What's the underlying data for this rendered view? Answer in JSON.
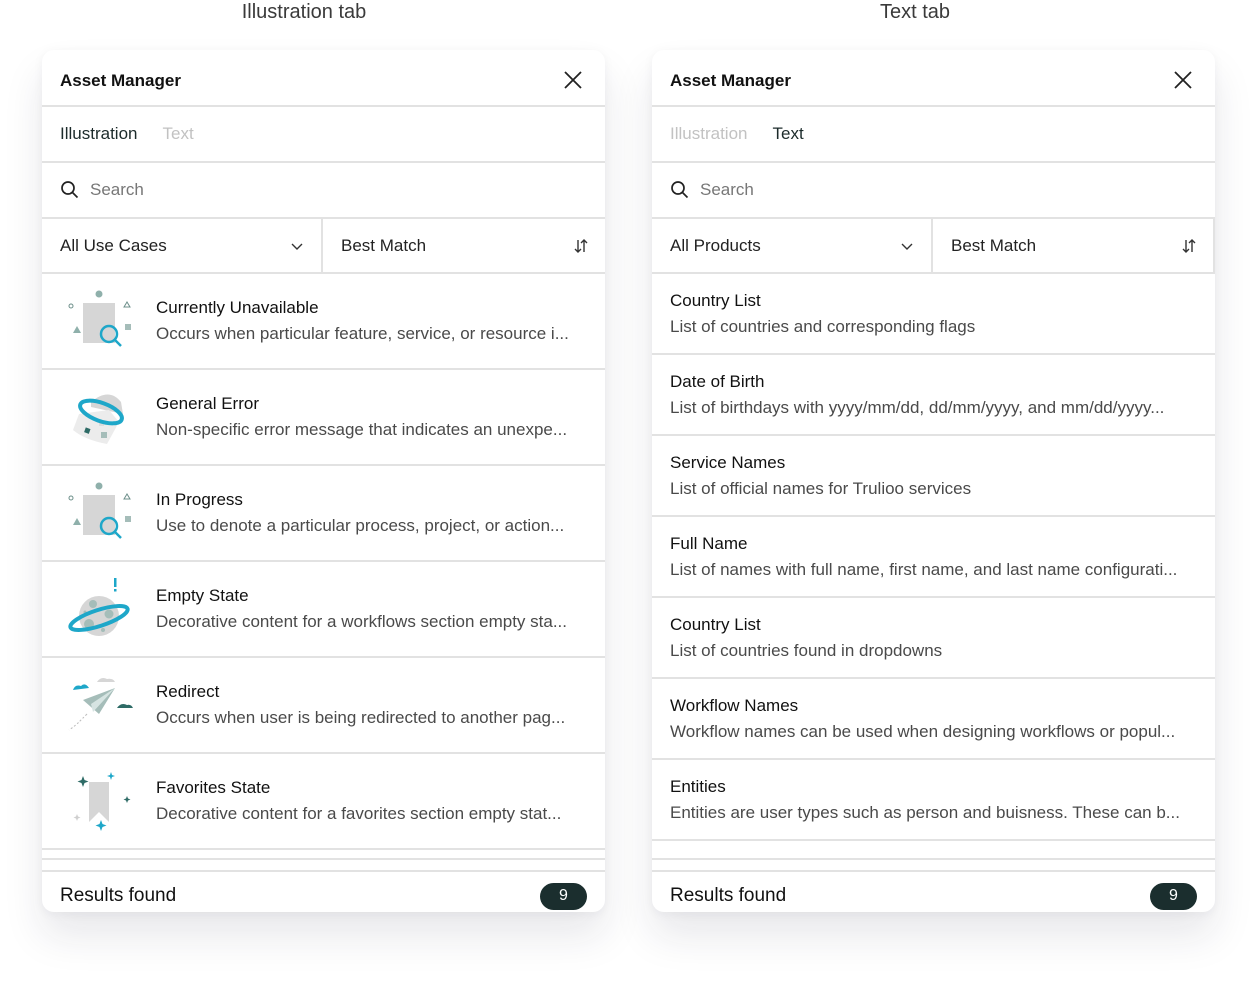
{
  "captions": {
    "left": "Illustration tab",
    "right": "Text tab"
  },
  "colors": {
    "accent_teal": "#1ea7c9",
    "dark_teal": "#2e6b66",
    "muted_teal": "#8fb0ab",
    "gray": "#d4d4d4",
    "badge_bg": "#1b2e2e"
  },
  "illustration_panel": {
    "title": "Asset Manager",
    "close_icon": "close-icon",
    "tabs": [
      {
        "label": "Illustration",
        "active": true
      },
      {
        "label": "Text",
        "active": false
      }
    ],
    "search": {
      "placeholder": "Search",
      "value": ""
    },
    "filter": {
      "selected": "All Use Cases",
      "icon": "chevron-down-icon"
    },
    "sort": {
      "selected": "Best Match",
      "icon": "sort-icon"
    },
    "items": [
      {
        "icon": "magnifier-illustration-icon",
        "title": "Currently Unavailable",
        "description": "Occurs when particular feature, service, or resource i..."
      },
      {
        "icon": "ufo-illustration-icon",
        "title": "General Error",
        "description": "Non-specific error message that indicates an unexpe..."
      },
      {
        "icon": "magnifier-illustration-icon",
        "title": "In Progress",
        "description": "Use to denote a particular process, project, or action..."
      },
      {
        "icon": "planet-illustration-icon",
        "title": "Empty State",
        "description": "Decorative content for a workflows section empty sta..."
      },
      {
        "icon": "paper-plane-illustration-icon",
        "title": "Redirect",
        "description": "Occurs when user is being redirected to another pag..."
      },
      {
        "icon": "bookmark-illustration-icon",
        "title": "Favorites State",
        "description": "Decorative content for a favorites section empty stat..."
      }
    ],
    "footer": {
      "label": "Results found",
      "count": "9"
    }
  },
  "text_panel": {
    "title": "Asset Manager",
    "close_icon": "close-icon",
    "tabs": [
      {
        "label": "Illustration",
        "active": false
      },
      {
        "label": "Text",
        "active": true
      }
    ],
    "search": {
      "placeholder": "Search",
      "value": ""
    },
    "filter": {
      "selected": "All Products",
      "icon": "chevron-down-icon"
    },
    "sort": {
      "selected": "Best Match",
      "icon": "sort-icon"
    },
    "items": [
      {
        "title": "Country List",
        "description": "List of countries and corresponding flags"
      },
      {
        "title": "Date of Birth",
        "description": "List of birthdays with yyyy/mm/dd, dd/mm/yyyy, and mm/dd/yyyy..."
      },
      {
        "title": "Service Names",
        "description": "List of official names for Trulioo services"
      },
      {
        "title": "Full Name",
        "description": "List of names with full name, first name, and last name configurati..."
      },
      {
        "title": "Country List",
        "description": "List of countries found in dropdowns"
      },
      {
        "title": "Workflow Names",
        "description": "Workflow names can be used when designing workflows or popul..."
      },
      {
        "title": "Entities",
        "description": "Entities are user types such as person and buisness. These can b..."
      }
    ],
    "footer": {
      "label": "Results found",
      "count": "9"
    }
  }
}
